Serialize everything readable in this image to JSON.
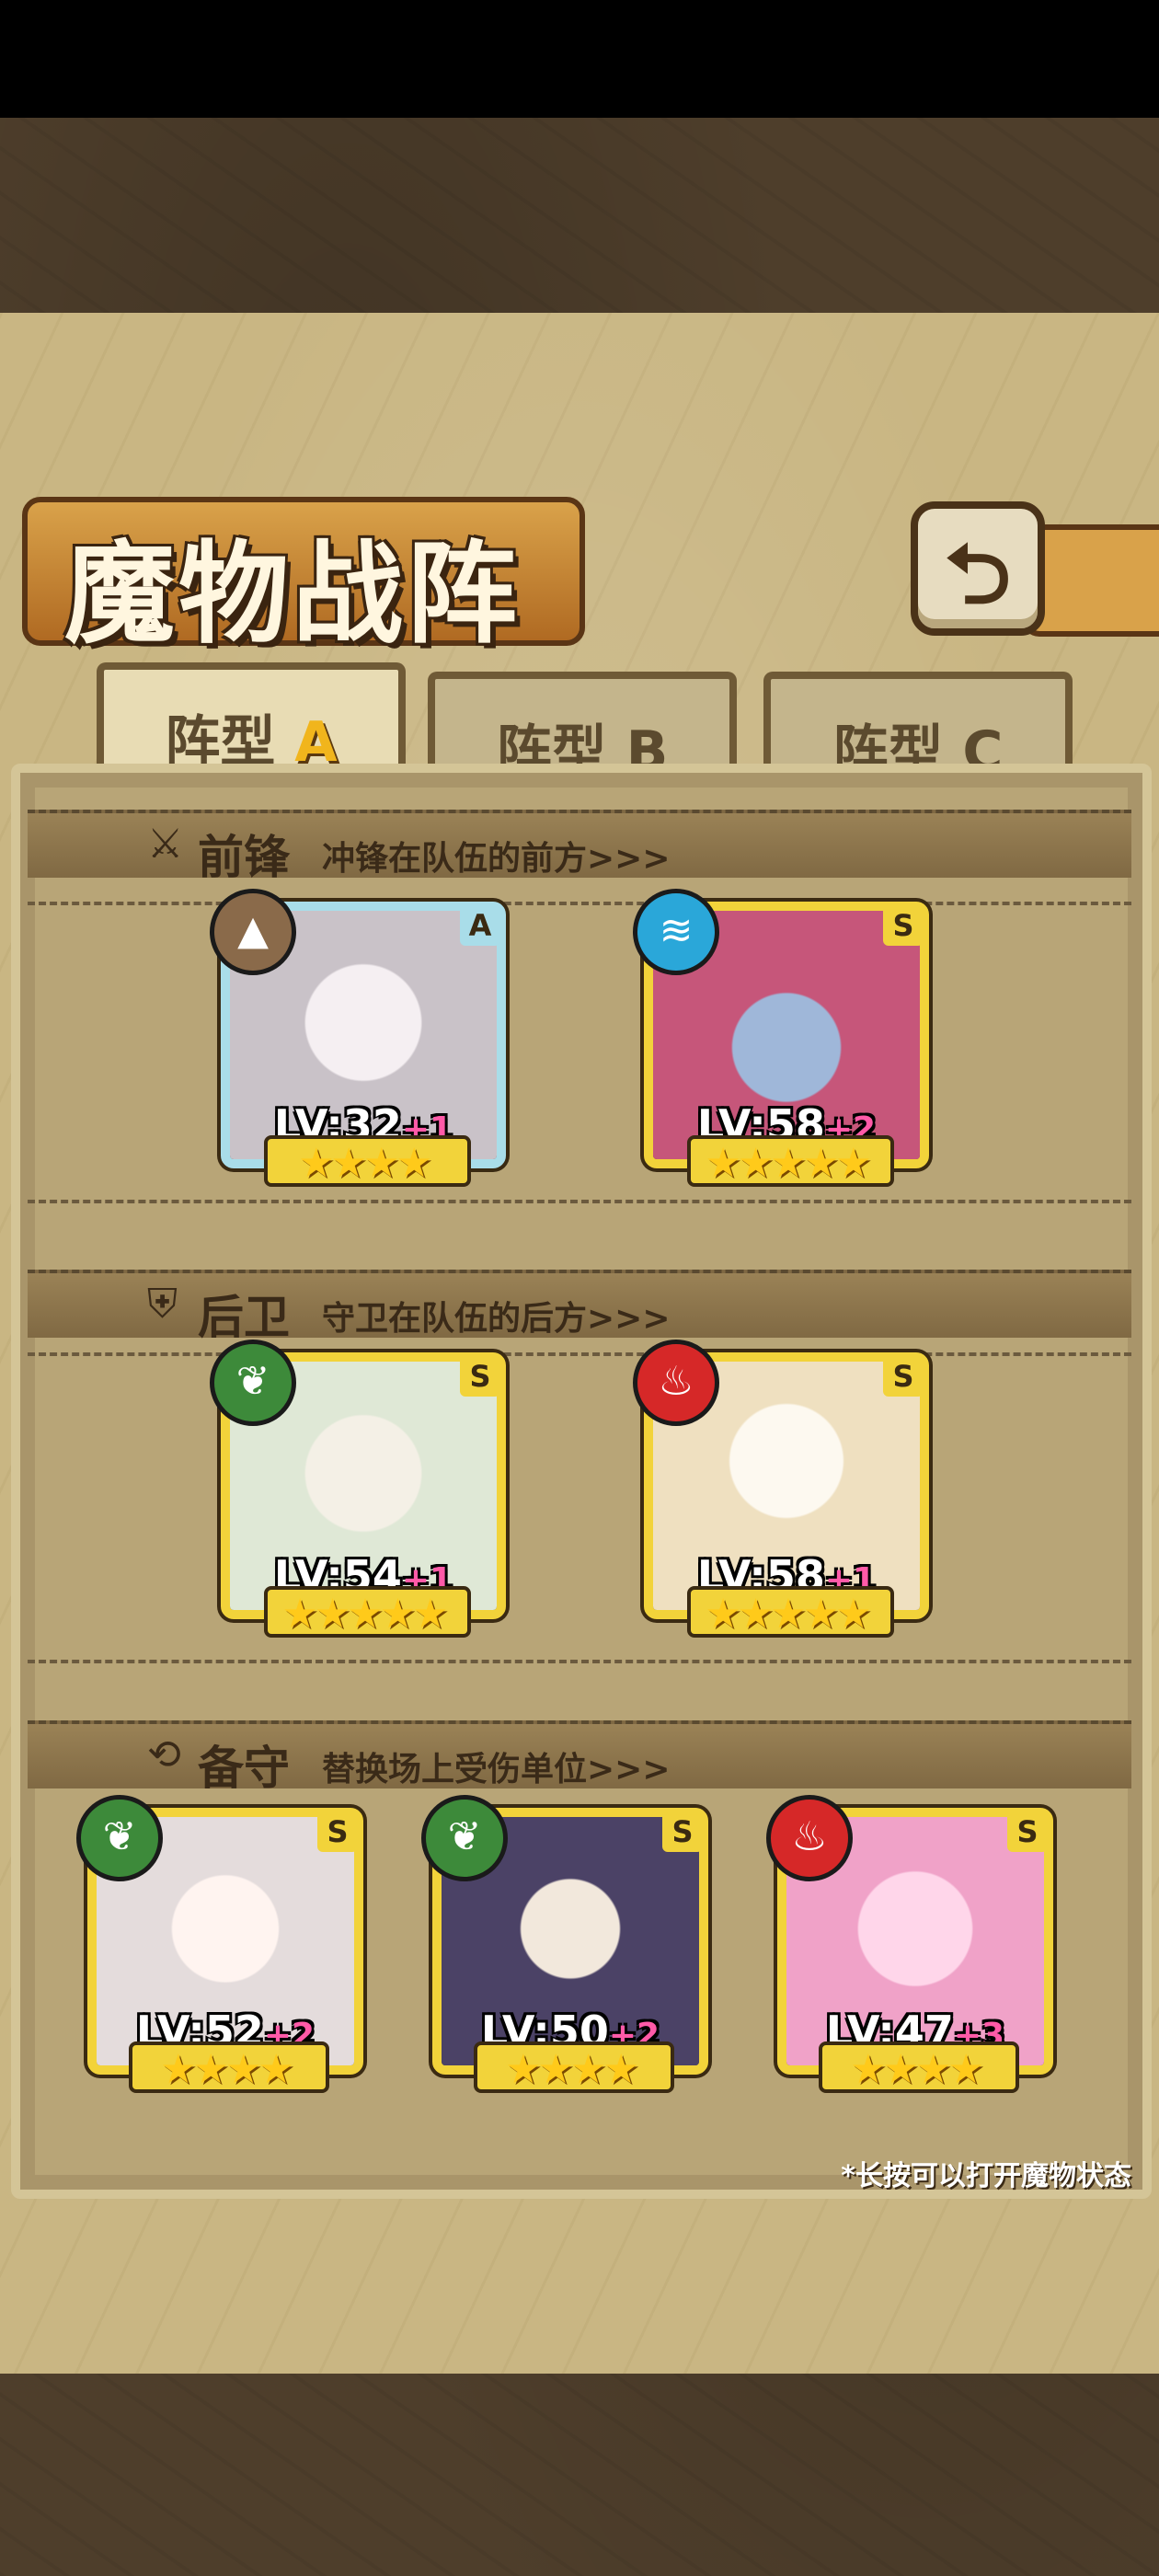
{
  "title": "魔物战阵",
  "back_icon": "return-arrow-icon",
  "tabs": [
    {
      "prefix": "阵型",
      "letter": "A",
      "active": true
    },
    {
      "prefix": "阵型",
      "letter": "B",
      "active": false
    },
    {
      "prefix": "阵型",
      "letter": "C",
      "active": false
    }
  ],
  "sections": {
    "front": {
      "title": "前锋",
      "desc": "冲锋在队伍的前方>>>",
      "icon": "sword-icon"
    },
    "rear": {
      "title": "后卫",
      "desc": "守卫在队伍的后方>>>",
      "icon": "shield-icon"
    },
    "reserve": {
      "title": "备守",
      "desc": "替换场上受伤单位>>>",
      "icon": "swap-icon"
    }
  },
  "units": {
    "front": [
      {
        "lv": "LV:32",
        "plus": "+1",
        "rank": "A",
        "element": "earth",
        "stars": "★★★★",
        "portrait": "#c9c2c8"
      },
      {
        "lv": "LV:58",
        "plus": "+2",
        "rank": "S",
        "element": "water",
        "stars": "★★★★★",
        "portrait": "#c6567a"
      }
    ],
    "rear": [
      {
        "lv": "LV:54",
        "plus": "+1",
        "rank": "S",
        "element": "leaf",
        "stars": "★★★★★",
        "portrait": "#dfe8d6"
      },
      {
        "lv": "LV:58",
        "plus": "+1",
        "rank": "S",
        "element": "fire",
        "stars": "★★★★★",
        "portrait": "#efe0c0"
      }
    ],
    "reserve": [
      {
        "lv": "LV:52",
        "plus": "+2",
        "rank": "S",
        "element": "leaf",
        "stars": "★★★★",
        "portrait": "#e4dcdc"
      },
      {
        "lv": "LV:50",
        "plus": "+2",
        "rank": "S",
        "element": "leaf",
        "stars": "★★★★",
        "portrait": "#4b4266"
      },
      {
        "lv": "LV:47",
        "plus": "+3",
        "rank": "S",
        "element": "fire",
        "stars": "★★★★",
        "portrait": "#f0a2c8"
      }
    ]
  },
  "hint": "*长按可以打开魔物状态"
}
